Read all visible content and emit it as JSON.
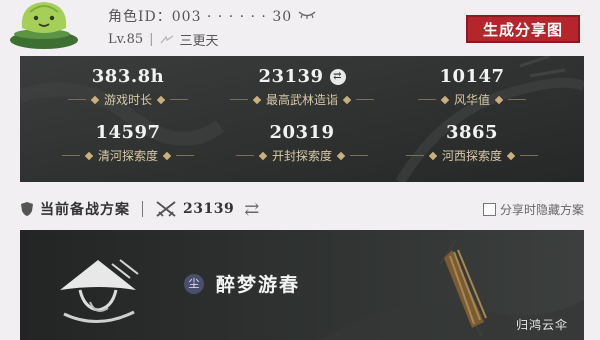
{
  "header": {
    "role_id_label": "角色ID：003 · · · · · · 30",
    "level": "Lv.85",
    "guild": "三更天",
    "share_button": "生成分享图"
  },
  "stats": [
    {
      "value": "383.8h",
      "label": "游戏时长"
    },
    {
      "value": "23139",
      "label": "最高武林造诣",
      "icon": "swap-icon"
    },
    {
      "value": "10147",
      "label": "风华值"
    },
    {
      "value": "14597",
      "label": "清河探索度"
    },
    {
      "value": "20319",
      "label": "开封探索度"
    },
    {
      "value": "3865",
      "label": "河西探索度"
    }
  ],
  "prep": {
    "title": "当前备战方案",
    "power": "23139",
    "hide_label": "分享时隐藏方案"
  },
  "weapon": {
    "skill_badge": "尘",
    "skill_name": "醉梦游春",
    "weapon_name": "归鸿云伞"
  },
  "colors": {
    "accent_red": "#b5262c",
    "panel_dark": "#2f3231",
    "label_gold": "#d9c9a6"
  }
}
